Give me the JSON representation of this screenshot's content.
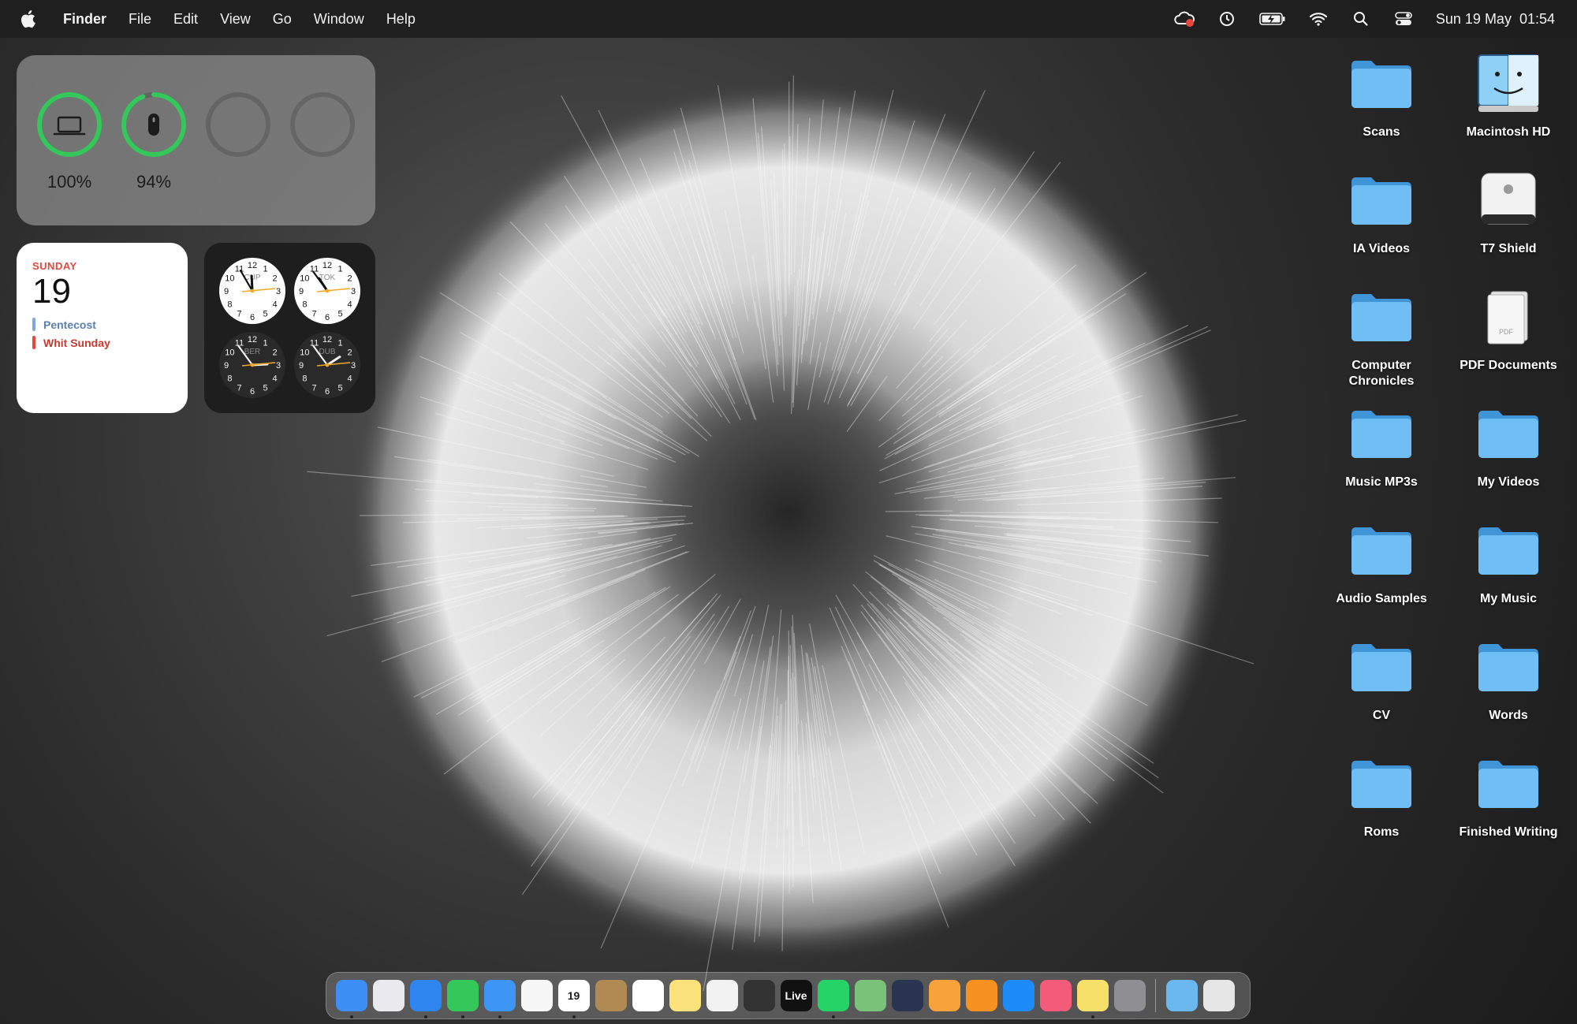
{
  "menubar": {
    "app_name": "Finder",
    "items": [
      "File",
      "Edit",
      "View",
      "Go",
      "Window",
      "Help"
    ],
    "datetime": "Sun 19 May  01:54",
    "status_icons": [
      "creative-cloud-icon",
      "time-machine-icon",
      "battery-charging-icon",
      "wifi-icon",
      "spotlight-search-icon",
      "control-center-icon"
    ]
  },
  "battery_widget": {
    "devices": [
      {
        "icon": "laptop-icon",
        "percent": 100,
        "label": "100%"
      },
      {
        "icon": "mouse-icon",
        "percent": 94,
        "label": "94%"
      },
      {
        "icon": "empty-slot",
        "percent": 0,
        "label": ""
      },
      {
        "icon": "empty-slot",
        "percent": 0,
        "label": ""
      }
    ],
    "ring_color": "#34c759"
  },
  "calendar_widget": {
    "weekday": "SUNDAY",
    "date": "19",
    "events": [
      {
        "title": "Pentecost",
        "color": "#7fa7d9"
      },
      {
        "title": "Whit Sunday",
        "color": "#e5483b"
      }
    ]
  },
  "clock_widget": {
    "clocks": [
      {
        "city": "CUP",
        "theme": "light",
        "hour": 11,
        "minute": 55
      },
      {
        "city": "TOK",
        "theme": "light",
        "hour": 10,
        "minute": 54
      },
      {
        "city": "BER",
        "theme": "dark",
        "hour": 2,
        "minute": 54
      },
      {
        "city": "DUB",
        "theme": "dark",
        "hour": 1,
        "minute": 54
      }
    ]
  },
  "desktop": {
    "items": [
      {
        "label": "Scans",
        "type": "folder"
      },
      {
        "label": "Macintosh HD",
        "type": "finder-disk"
      },
      {
        "label": "IA Videos",
        "type": "folder"
      },
      {
        "label": "T7 Shield",
        "type": "external-drive"
      },
      {
        "label": "Computer\nChronicles",
        "type": "folder"
      },
      {
        "label": "PDF Documents",
        "type": "pdf"
      },
      {
        "label": "Music MP3s",
        "type": "folder"
      },
      {
        "label": "My Videos",
        "type": "folder"
      },
      {
        "label": "Audio Samples",
        "type": "folder"
      },
      {
        "label": "My Music",
        "type": "folder"
      },
      {
        "label": "CV",
        "type": "folder"
      },
      {
        "label": "Words",
        "type": "folder"
      },
      {
        "label": "Roms",
        "type": "folder"
      },
      {
        "label": "Finished Writing",
        "type": "folder"
      }
    ]
  },
  "dock": {
    "apps": [
      {
        "name": "finder-icon",
        "color": "#3d8ff5",
        "running": true
      },
      {
        "name": "launchpad-icon",
        "color": "#e9e9ee",
        "running": false
      },
      {
        "name": "safari-icon",
        "color": "#2f86f0",
        "running": true
      },
      {
        "name": "messages-icon",
        "color": "#34c759",
        "running": true
      },
      {
        "name": "mail-icon",
        "color": "#3d95f5",
        "running": true
      },
      {
        "name": "photos-icon",
        "color": "#f7f7f7",
        "running": false
      },
      {
        "name": "calendar-icon",
        "color": "#ffffff",
        "running": true,
        "text": "19"
      },
      {
        "name": "contacts-icon",
        "color": "#b08a52",
        "running": false
      },
      {
        "name": "reminders-icon",
        "color": "#ffffff",
        "running": false
      },
      {
        "name": "notes-icon",
        "color": "#fbe27b",
        "running": false
      },
      {
        "name": "scrivener-icon",
        "color": "#f2f2f2",
        "running": false
      },
      {
        "name": "disk-utility-icon",
        "color": "#333333",
        "running": false
      },
      {
        "name": "live-icon",
        "color": "#111111",
        "running": false,
        "text": "Live"
      },
      {
        "name": "whatsapp-icon",
        "color": "#25d366",
        "running": true
      },
      {
        "name": "maps-icon",
        "color": "#7ac27a",
        "running": false
      },
      {
        "name": "robot-app-icon",
        "color": "#2a3552",
        "running": false
      },
      {
        "name": "pages-icon",
        "color": "#f7a23a",
        "running": false
      },
      {
        "name": "books-icon",
        "color": "#f7911f",
        "running": false
      },
      {
        "name": "app-store-icon",
        "color": "#1d8cf8",
        "running": false
      },
      {
        "name": "affinity-icon",
        "color": "#f25b7a",
        "running": false
      },
      {
        "name": "stickies-icon",
        "color": "#f7e06a",
        "running": true
      },
      {
        "name": "system-settings-icon",
        "color": "#8e8e93",
        "running": false
      }
    ],
    "right": [
      {
        "name": "downloads-folder-icon",
        "color": "#6bb8f0"
      },
      {
        "name": "trash-icon",
        "color": "#e6e6e6"
      }
    ]
  }
}
